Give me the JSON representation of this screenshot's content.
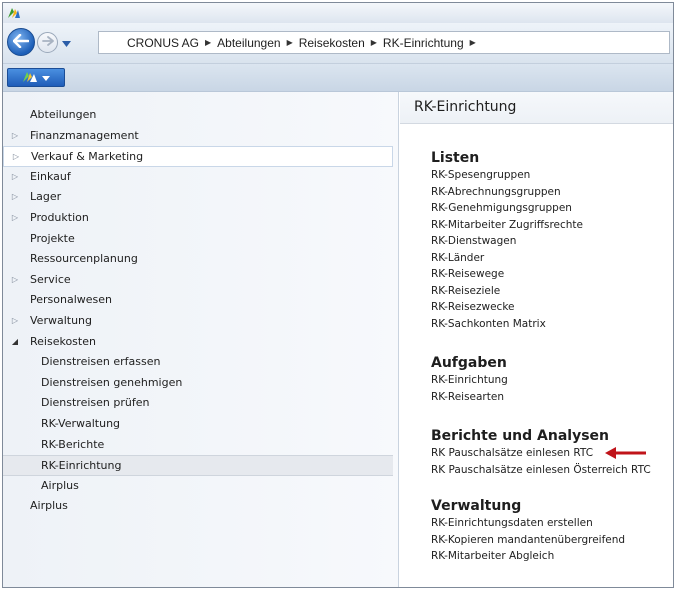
{
  "breadcrumb": [
    "CRONUS AG",
    "Abteilungen",
    "Reisekosten",
    "RK-Einrichtung"
  ],
  "sidebar": {
    "items": [
      {
        "label": "Abteilungen",
        "arrow": ""
      },
      {
        "label": "Finanzmanagement",
        "arrow": "▷"
      },
      {
        "label": "Verkauf & Marketing",
        "arrow": "▷"
      },
      {
        "label": "Einkauf",
        "arrow": "▷"
      },
      {
        "label": "Lager",
        "arrow": "▷"
      },
      {
        "label": "Produktion",
        "arrow": "▷"
      },
      {
        "label": "Projekte",
        "arrow": ""
      },
      {
        "label": "Ressourcenplanung",
        "arrow": ""
      },
      {
        "label": "Service",
        "arrow": "▷"
      },
      {
        "label": "Personalwesen",
        "arrow": ""
      },
      {
        "label": "Verwaltung",
        "arrow": "▷"
      },
      {
        "label": "Reisekosten",
        "arrow": "◢"
      },
      {
        "label": "Dienstreisen erfassen",
        "arrow": ""
      },
      {
        "label": "Dienstreisen genehmigen",
        "arrow": ""
      },
      {
        "label": "Dienstreisen prüfen",
        "arrow": ""
      },
      {
        "label": "RK-Verwaltung",
        "arrow": ""
      },
      {
        "label": "RK-Berichte",
        "arrow": ""
      },
      {
        "label": "RK-Einrichtung",
        "arrow": ""
      },
      {
        "label": "Airplus",
        "arrow": ""
      },
      {
        "label": "Airplus",
        "arrow": ""
      }
    ]
  },
  "main": {
    "title": "RK-Einrichtung",
    "groups": [
      {
        "title": "Listen",
        "links": [
          "RK-Spesengruppen",
          "RK-Abrechnungsgruppen",
          "RK-Genehmigungsgruppen",
          "RK-Mitarbeiter Zugriffsrechte",
          "RK-Dienstwagen",
          "RK-Länder",
          "RK-Reisewege",
          "RK-Reiseziele",
          "RK-Reisezwecke",
          "RK-Sachkonten Matrix"
        ]
      },
      {
        "title": "Aufgaben",
        "links": [
          "RK-Einrichtung",
          "RK-Reisearten"
        ]
      },
      {
        "title": "Berichte und Analysen",
        "links": [
          "RK Pauschalsätze einlesen RTC",
          "RK Pauschalsätze einlesen Österreich RTC"
        ]
      },
      {
        "title": "Verwaltung",
        "links": [
          "RK-Einrichtungsdaten erstellen",
          "RK-Kopieren mandantenübergreifend",
          "RK-Mitarbeiter Abgleich"
        ]
      }
    ]
  },
  "icons": {
    "app": "dynamics-nav-logo-icon",
    "back": "back-arrow-icon",
    "forward": "forward-arrow-icon",
    "dropdown": "chevron-down-icon",
    "highlight": "red-arrow-icon"
  },
  "colors": {
    "accent_blue": "#1f5cb8",
    "arrow_red": "#c0141a"
  }
}
